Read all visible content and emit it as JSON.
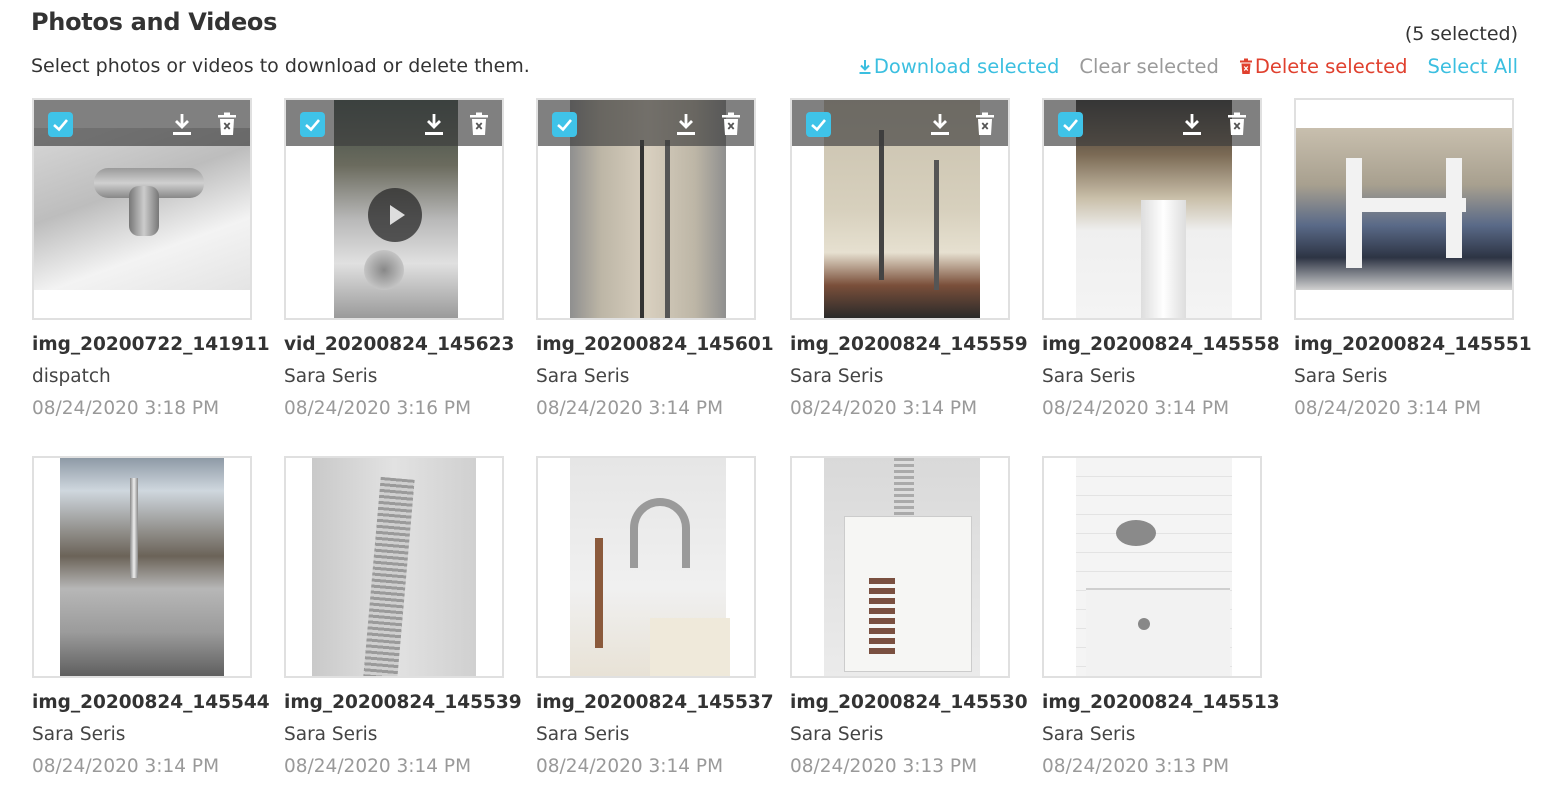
{
  "header": {
    "title": "Photos and Videos",
    "subtitle": "Select photos or videos to download or delete them.",
    "selected_count": "(5 selected)"
  },
  "actions": {
    "download": "Download selected",
    "clear": "Clear selected",
    "delete": "Delete selected",
    "select_all": "Select All"
  },
  "colors": {
    "accent": "#3bbfe0",
    "delete": "#e0402e",
    "muted": "#9a9a9a",
    "checkbox": "#3fc3e8"
  },
  "items": [
    {
      "name": "img_20200722_141911",
      "author": "dispatch",
      "date": "08/24/2020 3:18 PM",
      "selected": true,
      "video": false
    },
    {
      "name": "vid_20200824_145623",
      "author": "Sara Seris",
      "date": "08/24/2020 3:16 PM",
      "selected": true,
      "video": true
    },
    {
      "name": "img_20200824_145601",
      "author": "Sara Seris",
      "date": "08/24/2020 3:14 PM",
      "selected": true,
      "video": false
    },
    {
      "name": "img_20200824_145559",
      "author": "Sara Seris",
      "date": "08/24/2020 3:14 PM",
      "selected": true,
      "video": false
    },
    {
      "name": "img_20200824_145558",
      "author": "Sara Seris",
      "date": "08/24/2020 3:14 PM",
      "selected": true,
      "video": false
    },
    {
      "name": "img_20200824_145551",
      "author": "Sara Seris",
      "date": "08/24/2020 3:14 PM",
      "selected": false,
      "video": false
    },
    {
      "name": "img_20200824_145544",
      "author": "Sara Seris",
      "date": "08/24/2020 3:14 PM",
      "selected": false,
      "video": false
    },
    {
      "name": "img_20200824_145539",
      "author": "Sara Seris",
      "date": "08/24/2020 3:14 PM",
      "selected": false,
      "video": false
    },
    {
      "name": "img_20200824_145537",
      "author": "Sara Seris",
      "date": "08/24/2020 3:14 PM",
      "selected": false,
      "video": false
    },
    {
      "name": "img_20200824_145530",
      "author": "Sara Seris",
      "date": "08/24/2020 3:13 PM",
      "selected": false,
      "video": false
    },
    {
      "name": "img_20200824_145513",
      "author": "Sara Seris",
      "date": "08/24/2020 3:13 PM",
      "selected": false,
      "video": false
    }
  ]
}
